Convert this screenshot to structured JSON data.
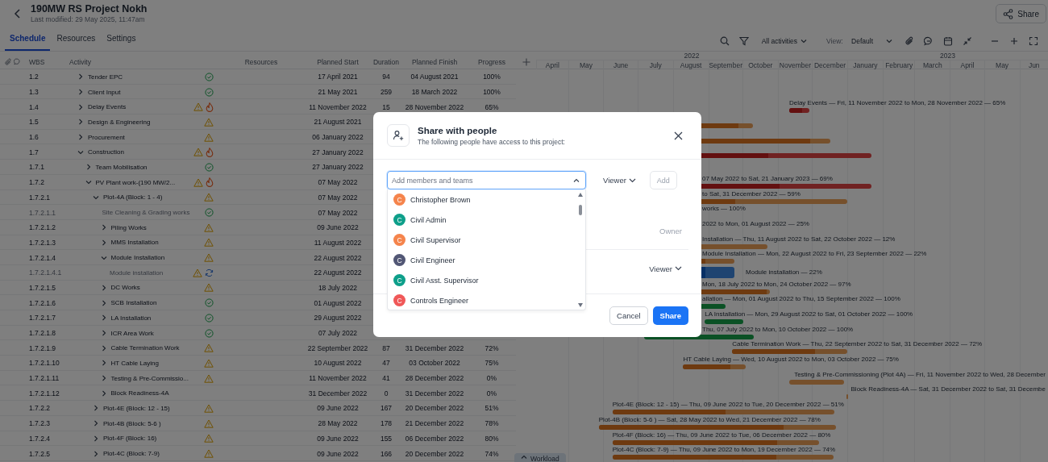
{
  "header": {
    "title": "190MW RS Project Nokh",
    "subtitle": "Last modified: 29 May 2025, 11:47am",
    "share_label": "Share"
  },
  "tabs": [
    {
      "label": "Schedule",
      "selected": true
    },
    {
      "label": "Resources",
      "selected": false
    },
    {
      "label": "Settings",
      "selected": false
    }
  ],
  "toolbar": {
    "filter_label": "All activities",
    "view_label": "View:",
    "view_value": "Default"
  },
  "table": {
    "columns": [
      "WBS",
      "Activity",
      "Resources",
      "Planned Start",
      "Duration",
      "Planned Finish",
      "Progress"
    ],
    "rows": [
      {
        "wbs": "1.2",
        "activity": "Tender EPC",
        "expanded": false,
        "status": [
          {
            "kind": "check"
          }
        ],
        "start": "17 April 2021",
        "duration": "94",
        "finish": "04 August 2021",
        "progress": "100%"
      },
      {
        "wbs": "1.3",
        "activity": "Client Input",
        "expanded": false,
        "status": [
          {
            "kind": "check"
          }
        ],
        "start": "21 May 2021",
        "duration": "259",
        "finish": "18 March 2022",
        "progress": "100%"
      },
      {
        "wbs": "1.4",
        "activity": "Delay Events",
        "expanded": false,
        "status": [
          {
            "kind": "warning"
          },
          {
            "kind": "fire"
          }
        ],
        "start": "11 November 2022",
        "duration": "15",
        "finish": "28 November 2022",
        "progress": "65%",
        "bar": {
          "kind": "critical",
          "level": 0.65,
          "label": "Delay Events — Fri, 11 November 2022 to Mon, 28 November 2022 — 65%"
        }
      },
      {
        "wbs": "1.5",
        "activity": "Design & Engineering",
        "expanded": false,
        "status": [
          {
            "kind": "warning"
          }
        ],
        "start": "21 August 2021",
        "bar": {
          "kind": "warning",
          "level": 0.97
        }
      },
      {
        "wbs": "1.6",
        "activity": "Procurement",
        "expanded": false,
        "status": [
          {
            "kind": "warning"
          }
        ],
        "start": "06 January 2022",
        "bar": {
          "kind": "warning",
          "level": 0.95
        }
      },
      {
        "wbs": "1.7",
        "activity": "Construction",
        "expanded": true,
        "status": [
          {
            "kind": "warning"
          },
          {
            "kind": "fire"
          }
        ],
        "start": "27 January 2022",
        "bar": {
          "kind": "critical",
          "level": 0.75
        },
        "children": [
          {
            "wbs": "1.7.1",
            "activity": "Team Mobilisation",
            "expanded": false,
            "status": [
              {
                "kind": "check"
              }
            ],
            "start": "27 January 2022"
          },
          {
            "wbs": "1.7.2",
            "activity": "PV Plant work-(190 MW/2...",
            "expanded": true,
            "status": [
              {
                "kind": "warning"
              },
              {
                "kind": "fire"
              }
            ],
            "start": "07 May 2022",
            "bar": {
              "kind": "critical",
              "level": 0.69,
              "label_cut": "07 May 2022 to Sat, 21 January 2023 — 69%"
            },
            "children": [
              {
                "wbs": "1.7.2.1",
                "activity": "Plot-4A (Block: 1 - 4)",
                "expanded": true,
                "status": [
                  {
                    "kind": "warning"
                  }
                ],
                "start": "07 May 2022",
                "bar": {
                  "kind": "warning",
                  "level": 0.59,
                  "label_cut": "to Sat, 31 December 2022 — 59%"
                },
                "children": [
                  {
                    "wbs": "1.7.2.1.1",
                    "activity": "Site Cleaning & Grading works",
                    "status": [
                      {
                        "kind": "check"
                      }
                    ],
                    "start": "07 May 2022",
                    "bar": {
                      "label_cut": "works — 100%"
                    }
                  },
                  {
                    "wbs": "1.7.2.1.2",
                    "activity": "Piling Works",
                    "expanded": false,
                    "status": [
                      {
                        "kind": "warning"
                      }
                    ],
                    "start": "09 June 2022",
                    "bar": {
                      "label_cut": "2022 to Mon, 01 August 2022 — 25%"
                    }
                  },
                  {
                    "wbs": "1.7.2.1.3",
                    "activity": "MMS Installation",
                    "expanded": false,
                    "status": [
                      {
                        "kind": "warning"
                      }
                    ],
                    "start": "11 August 2022",
                    "bar": {
                      "kind": "warning",
                      "label_cut": "Installation — Thu, 11 August 2022 to Sat, 22 October 2022 — 12%"
                    }
                  },
                  {
                    "wbs": "1.7.2.1.4",
                    "activity": "Module Installation",
                    "expanded": true,
                    "status": [
                      {
                        "kind": "warning"
                      }
                    ],
                    "start": "22 August 2022",
                    "bar": {
                      "kind": "warning",
                      "level": 0.22,
                      "label_cut": "Module Installation — Mon, 22 August 2022 to Fri, 23 September 2022 — 22%"
                    },
                    "children": [
                      {
                        "wbs": "1.7.2.1.4.1",
                        "activity": "Module installation",
                        "status": [
                          {
                            "kind": "warning"
                          },
                          {
                            "kind": "sync"
                          }
                        ],
                        "start": "22 August 2022",
                        "bar": {
                          "kind": "active",
                          "level": 0.22,
                          "label_after": "Module installation — 22%"
                        }
                      }
                    ]
                  },
                  {
                    "wbs": "1.7.2.1.5",
                    "activity": "DC Works",
                    "expanded": false,
                    "status": [
                      {
                        "kind": "warning"
                      }
                    ],
                    "start": "18 July 2022",
                    "bar": {
                      "kind": "warning",
                      "level": 0.97,
                      "label_cut": "Mon, 18 July 2022 to Mon, 24 October 2022 — 97%"
                    }
                  },
                  {
                    "wbs": "1.7.2.1.6",
                    "activity": "SCB Installation",
                    "expanded": false,
                    "status": [
                      {
                        "kind": "check"
                      }
                    ],
                    "start": "01 August 2022",
                    "bar": {
                      "kind": "complete",
                      "label_cut": "allation — Mon, 01 August 2022 to Thu, 15 September 2022 — 100%"
                    }
                  },
                  {
                    "wbs": "1.7.2.1.7",
                    "activity": "LA Installation",
                    "expanded": false,
                    "status": [
                      {
                        "kind": "check"
                      }
                    ],
                    "start": "29 August 2022",
                    "bar": {
                      "kind": "complete",
                      "label": "LA Installation — Mon, 29 August 2022 to Sat, 01 October 2022 — 100%"
                    }
                  },
                  {
                    "wbs": "1.7.2.1.8",
                    "activity": "ICR Area Work",
                    "expanded": false,
                    "status": [
                      {
                        "kind": "check"
                      }
                    ],
                    "start": "07 July 2022",
                    "bar": {
                      "kind": "complete",
                      "label_cut": "Thu, 07 July 2022 to Mon, 10 October 2022 — 100%"
                    }
                  },
                  {
                    "wbs": "1.7.2.1.9",
                    "activity": "Cable Termination Work",
                    "expanded": false,
                    "status": [
                      {
                        "kind": "warning"
                      }
                    ],
                    "start": "22 September 2022",
                    "duration": "87",
                    "finish": "31 December 2022",
                    "progress": "72%",
                    "bar": {
                      "kind": "warning",
                      "level": 0.72,
                      "label": "Cable Termination Work — Thu, 22 September 2022 to Sat, 31 December 2022 — 72%"
                    }
                  },
                  {
                    "wbs": "1.7.2.1.10",
                    "activity": "HT Cable Laying",
                    "expanded": false,
                    "status": [
                      {
                        "kind": "warning"
                      }
                    ],
                    "start": "10 August 2022",
                    "duration": "47",
                    "finish": "03 October 2022",
                    "progress": "75%",
                    "bar": {
                      "kind": "warning",
                      "level": 0.75,
                      "label": "HT Cable Laying — Wed, 10 August 2022 to Mon, 03 October 2022 — 75%"
                    }
                  },
                  {
                    "wbs": "1.7.2.1.11",
                    "activity": "Testing & Pre-Commissio...",
                    "expanded": false,
                    "status": [
                      {
                        "kind": "warning"
                      }
                    ],
                    "start": "11 November 2022",
                    "duration": "41",
                    "finish": "28 December 2022",
                    "progress": "0%",
                    "bar": {
                      "kind": "warning",
                      "label_edge": "Testing & Pre-Commissioning (Plot 4A) — Fri, 11 November 2022 to Wed, 28 December"
                    }
                  },
                  {
                    "wbs": "1.7.2.1.12",
                    "activity": "Block Readiness-4A",
                    "expanded": false,
                    "start": "31 December 2022",
                    "duration": "0",
                    "finish": "31 December 2022",
                    "progress": "0%",
                    "bar": {
                      "kind": "warning",
                      "label_edge": "Block Readiness-4A — Sat, 31 December 2022 to Sat, 31 Decembe"
                    }
                  }
                ]
              },
              {
                "wbs": "1.7.2.2",
                "activity": "Plot-4E (Block: 12 - 15)",
                "expanded": false,
                "status": [
                  {
                    "kind": "warning"
                  }
                ],
                "start": "09 June 2022",
                "duration": "167",
                "finish": "20 December 2022",
                "progress": "51%",
                "bar": {
                  "kind": "warning",
                  "level": 0.51,
                  "label": "Plot-4E (Block: 12 - 15) — Thu, 09 June 2022 to Tue, 20 December 2022 — 51%"
                }
              },
              {
                "wbs": "1.7.2.3",
                "activity": "Plot-4B (Block: 5-6 )",
                "expanded": false,
                "status": [
                  {
                    "kind": "warning"
                  }
                ],
                "start": "28 May 2022",
                "duration": "178",
                "finish": "21 December 2022",
                "progress": "78%",
                "bar": {
                  "kind": "warning",
                  "level": 0.78,
                  "label": "Plot-4B (Block: 5-6 ) — Sat, 28 May 2022 to Wed, 21 December 2022 — 78%"
                }
              },
              {
                "wbs": "1.7.2.4",
                "activity": "Plot-4F (Block: 16)",
                "expanded": false,
                "status": [
                  {
                    "kind": "warning"
                  }
                ],
                "start": "09 June 2022",
                "duration": "155",
                "finish": "06 December 2022",
                "progress": "80%",
                "bar": {
                  "kind": "warning",
                  "level": 0.8,
                  "label": "Plot-4F (Block: 16) — Thu, 09 June 2022 to Tue, 06 December 2022 — 80%"
                }
              },
              {
                "wbs": "1.7.2.5",
                "activity": "Plot-4C (Block: 7-9)",
                "expanded": false,
                "status": [
                  {
                    "kind": "warning"
                  }
                ],
                "start": "09 June 2022",
                "duration": "166",
                "finish": "20 December 2022",
                "progress": "74%",
                "bar": {
                  "kind": "warning",
                  "level": 0.74,
                  "label": "Plot-4C (Block: 7-9) — Thu, 09 June 2022 to Mon, 19 December 2022 — 74%"
                }
              }
            ]
          }
        ]
      }
    ]
  },
  "gantt": {
    "years": [
      {
        "label": "2022",
        "months": [
          "April",
          "May",
          "June",
          "July",
          "August",
          "September",
          "October",
          "November",
          "December"
        ]
      },
      {
        "label": "2023",
        "months": [
          "January",
          "February",
          "March",
          "April",
          "May",
          "Jun"
        ]
      }
    ]
  },
  "workload_tab": {
    "label": "Workload"
  },
  "dialog": {
    "title": "Share with people",
    "subtitle": "The following people have access to this project:",
    "search": {
      "placeholder": "Add members and teams",
      "expanded": true
    },
    "role_select": "Viewer",
    "add_button": {
      "label": "Add",
      "disabled": true
    },
    "suggestions": [
      {
        "initial": "C",
        "name": "Christopher Brown",
        "color": "#f5844c"
      },
      {
        "initial": "C",
        "name": "Civil Admin",
        "color": "#0e9f8a"
      },
      {
        "initial": "C",
        "name": "Civil Supervisor",
        "color": "#f5844c"
      },
      {
        "initial": "C",
        "name": "Civil Engineer",
        "color": "#525775"
      },
      {
        "initial": "C",
        "name": "Civil Asst. Supervisor",
        "color": "#0e9f8a"
      },
      {
        "initial": "C",
        "name": "Controls Engineer",
        "color": "#f05858"
      }
    ],
    "members": [
      {
        "role": "Owner",
        "editable": false
      },
      {
        "role": "Viewer",
        "editable": true
      }
    ],
    "cancel_label": "Cancel",
    "share_label": "Share"
  }
}
